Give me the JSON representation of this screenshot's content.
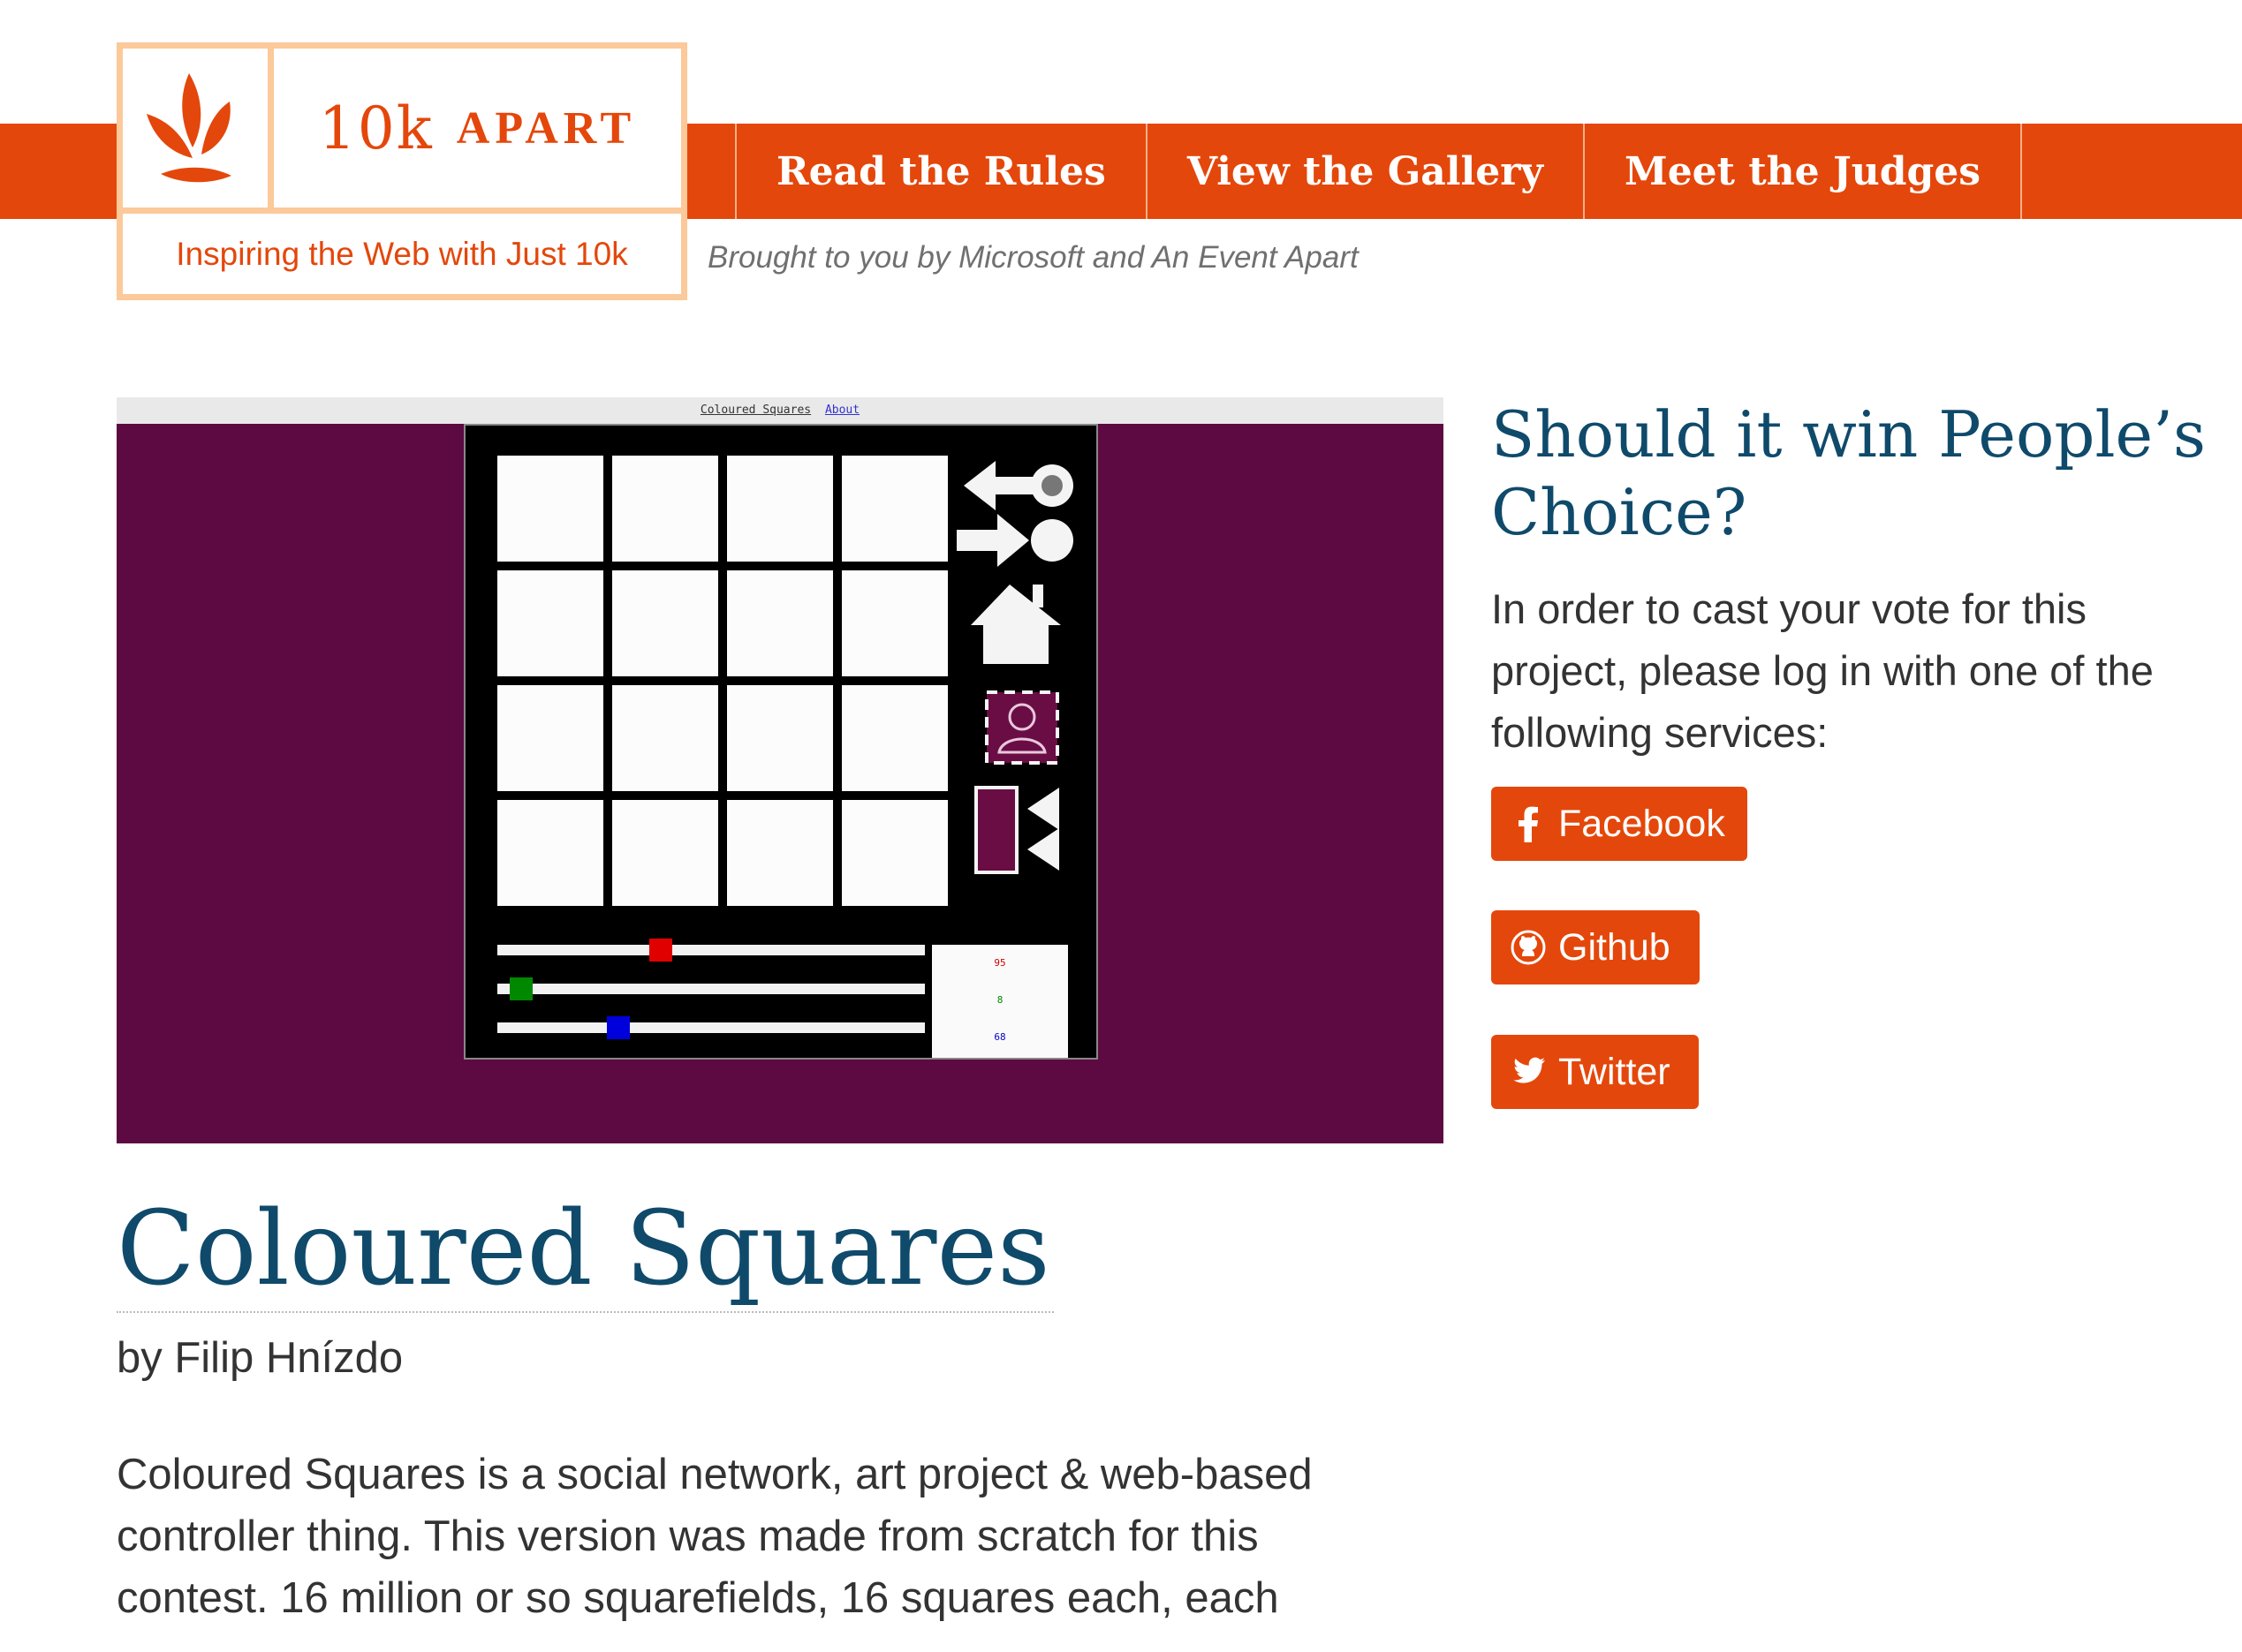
{
  "logo": {
    "number": "10k",
    "word": "APART",
    "tagline": "Inspiring the Web with Just 10k"
  },
  "nav": {
    "items": [
      {
        "label": "Read the Rules"
      },
      {
        "label": "View the Gallery"
      },
      {
        "label": "Meet the Judges"
      }
    ]
  },
  "sponsor_line": "Brought to you by Microsoft and An Event Apart",
  "hero": {
    "topbar_title": "Coloured Squares",
    "topbar_link": "About",
    "readout": [
      "95",
      "8",
      "68"
    ]
  },
  "vote": {
    "title": "Should it win People’s Choice?",
    "text": "In order to cast your vote for this project, please log in with one of the following services:",
    "services": [
      {
        "label": "Facebook",
        "icon": "facebook-icon"
      },
      {
        "label": "Github",
        "icon": "github-icon"
      },
      {
        "label": "Twitter",
        "icon": "twitter-icon"
      }
    ]
  },
  "article": {
    "title": "Coloured Squares",
    "byline": "by Filip Hnízdo",
    "description": "Coloured Squares is a social network, art project & web-based controller thing. This version was made from scratch for this contest. 16 million or so squarefields, 16 squares each, each"
  },
  "colors": {
    "accent": "#e4470b",
    "logo_border": "#fbc99a",
    "heading": "#0f4a6b",
    "hero_bg": "#5c0a41"
  }
}
